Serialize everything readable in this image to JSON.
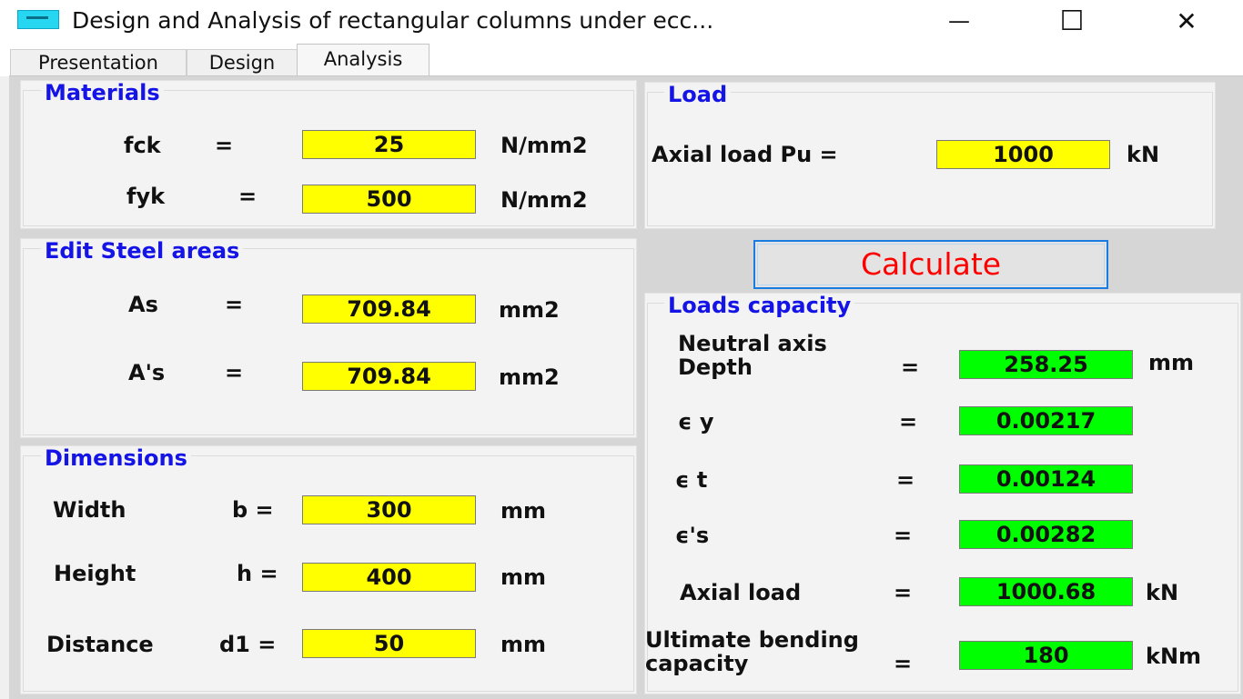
{
  "window": {
    "title": "Design and Analysis of rectangular columns under ecc...",
    "minimize_glyph": "—",
    "maximize_glyph": "☐",
    "close_glyph": "✕"
  },
  "tabs": [
    {
      "label": "Presentation",
      "active": false
    },
    {
      "label": "Design",
      "active": false
    },
    {
      "label": "Analysis",
      "active": true
    }
  ],
  "materials": {
    "legend": "Materials",
    "fck_label": "fck",
    "fck_eq": "=",
    "fck_value": "25",
    "fck_unit": "N/mm2",
    "fyk_label": "fyk",
    "fyk_eq": "=",
    "fyk_value": "500",
    "fyk_unit": "N/mm2"
  },
  "load": {
    "legend": "Load",
    "axial_label": "Axial load Pu =",
    "axial_value": "1000",
    "axial_unit": "kN"
  },
  "steel": {
    "legend": "Edit Steel areas",
    "as_label": "As",
    "as_eq": "=",
    "as_value": "709.84",
    "as_unit": "mm2",
    "as2_label": "A's",
    "as2_eq": "=",
    "as2_value": "709.84",
    "as2_unit": "mm2"
  },
  "calculate_label": "Calculate",
  "capacity": {
    "legend": "Loads capacity",
    "na_label_1": "Neutral axis",
    "na_label_2": "Depth",
    "na_eq": "=",
    "na_value": "258.25",
    "na_unit": "mm",
    "ey_label": "ϵ y",
    "ey_eq": "=",
    "ey_value": "0.00217",
    "et_label": "ϵ t",
    "et_eq": "=",
    "et_value": "0.00124",
    "es_label": "ϵ's",
    "es_eq": "=",
    "es_value": "0.00282",
    "axial_label": "Axial load",
    "axial_eq": "=",
    "axial_value": "1000.68",
    "axial_unit": "kN",
    "bend_label_1": "Ultimate bending",
    "bend_label_2": "capacity",
    "bend_eq": "=",
    "bend_value": "180",
    "bend_unit": "kNm"
  },
  "dimensions": {
    "legend": "Dimensions",
    "width_label": "Width",
    "width_sym": "b =",
    "width_value": "300",
    "width_unit": "mm",
    "height_label": "Height",
    "height_sym": "h =",
    "height_value": "400",
    "height_unit": "mm",
    "dist_label": "Distance",
    "dist_sym": "d1 =",
    "dist_value": "50",
    "dist_unit": "mm"
  },
  "colors": {
    "legend": "#1414e6",
    "input_bg": "#ffff00",
    "output_bg": "#00ff00",
    "calculate_text": "#ff0000",
    "calculate_border": "#1a7be0"
  }
}
